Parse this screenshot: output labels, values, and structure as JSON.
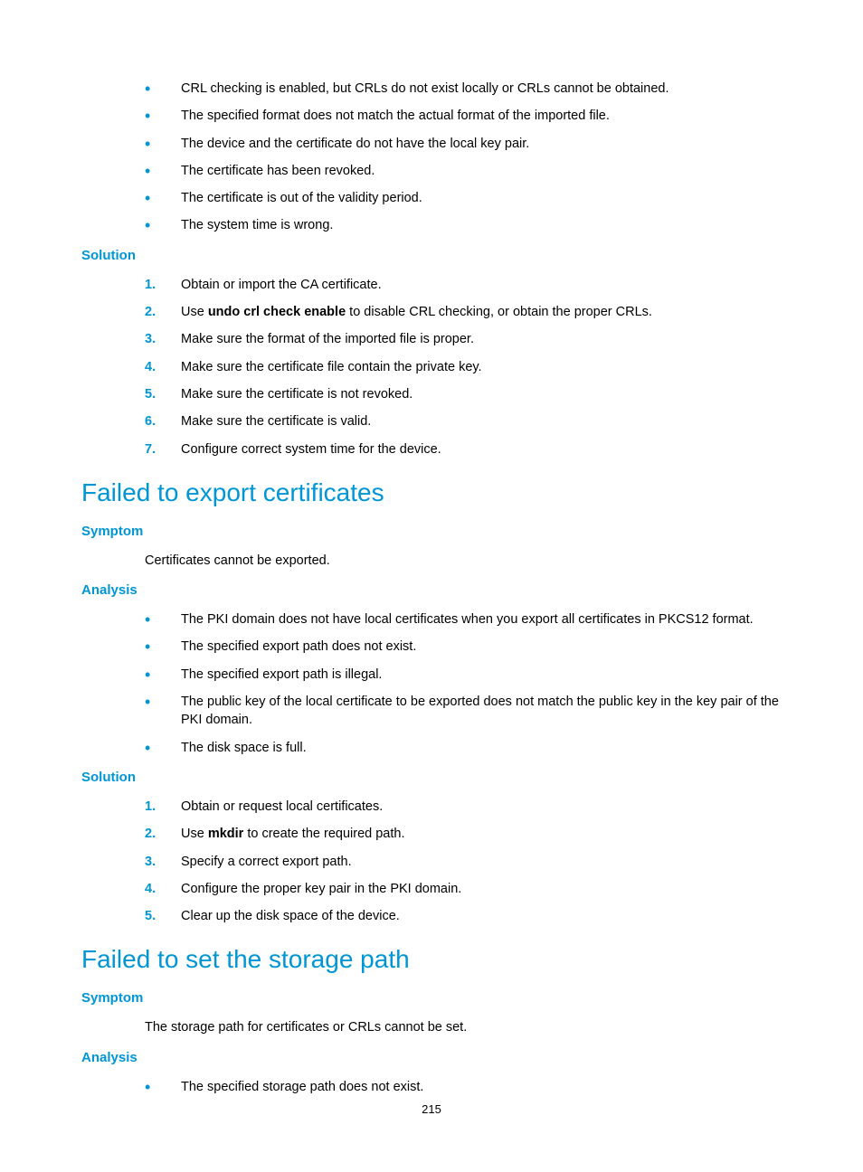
{
  "topBullets": [
    "CRL checking is enabled, but CRLs do not exist locally or CRLs cannot be obtained.",
    "The specified format does not match the actual format of the imported file.",
    "The device and the certificate do not have the local key pair.",
    "The certificate has been revoked.",
    "The certificate is out of the validity period.",
    "The system time is wrong."
  ],
  "solution1Heading": "Solution",
  "solution1": {
    "item1": "Obtain or import the CA certificate.",
    "item2_pre": "Use ",
    "item2_bold": "undo crl check enable",
    "item2_post": " to disable CRL checking, or obtain the proper CRLs.",
    "item3": "Make sure the format of the imported file is proper.",
    "item4": "Make sure the certificate file contain the private key.",
    "item5": "Make sure the certificate is not revoked.",
    "item6": "Make sure the certificate is valid.",
    "item7": "Configure correct system time for the device."
  },
  "section1Heading": "Failed to export certificates",
  "symptom1Heading": "Symptom",
  "symptom1Text": "Certificates cannot be exported.",
  "analysis1Heading": "Analysis",
  "analysis1Bullets": [
    "The PKI domain does not have local certificates when you export all certificates in PKCS12 format.",
    "The specified export path does not exist.",
    "The specified export path is illegal.",
    "The public key of the local certificate to be exported does not match the public key in the key pair of the PKI domain.",
    "The disk space is full."
  ],
  "solution2Heading": "Solution",
  "solution2": {
    "item1": "Obtain or request local certificates.",
    "item2_pre": "Use ",
    "item2_bold": "mkdir",
    "item2_post": " to create the required path.",
    "item3": "Specify a correct export path.",
    "item4": "Configure the proper key pair in the PKI domain.",
    "item5": "Clear up the disk space of the device."
  },
  "section2Heading": "Failed to set the storage path",
  "symptom2Heading": "Symptom",
  "symptom2Text": "The storage path for certificates or CRLs cannot be set.",
  "analysis2Heading": "Analysis",
  "analysis2Bullets": [
    "The specified storage path does not exist."
  ],
  "pageNumber": "215"
}
